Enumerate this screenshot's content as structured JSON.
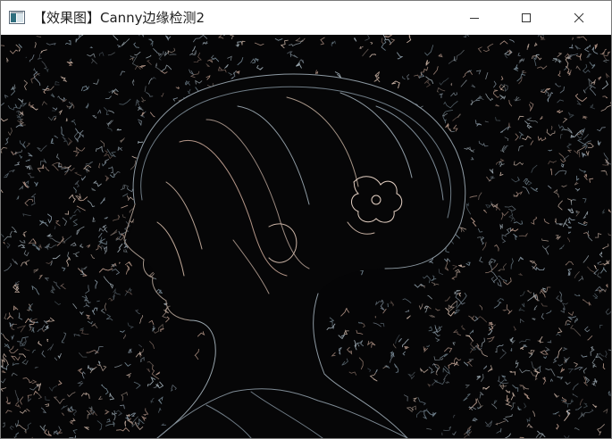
{
  "window": {
    "title": "【效果图】Canny边缘检测2",
    "icon": "opencv-window-icon",
    "controls": {
      "minimize_icon": "minimize-icon",
      "maximize_icon": "maximize-icon",
      "close_icon": "close-icon"
    }
  },
  "image": {
    "description_icon": "canny-edge-image",
    "background_color": "#050506",
    "edge_colors": [
      "#9aa6ae",
      "#b29486",
      "#7f8d98",
      "#c9b2a4",
      "#6e7f8a"
    ]
  }
}
